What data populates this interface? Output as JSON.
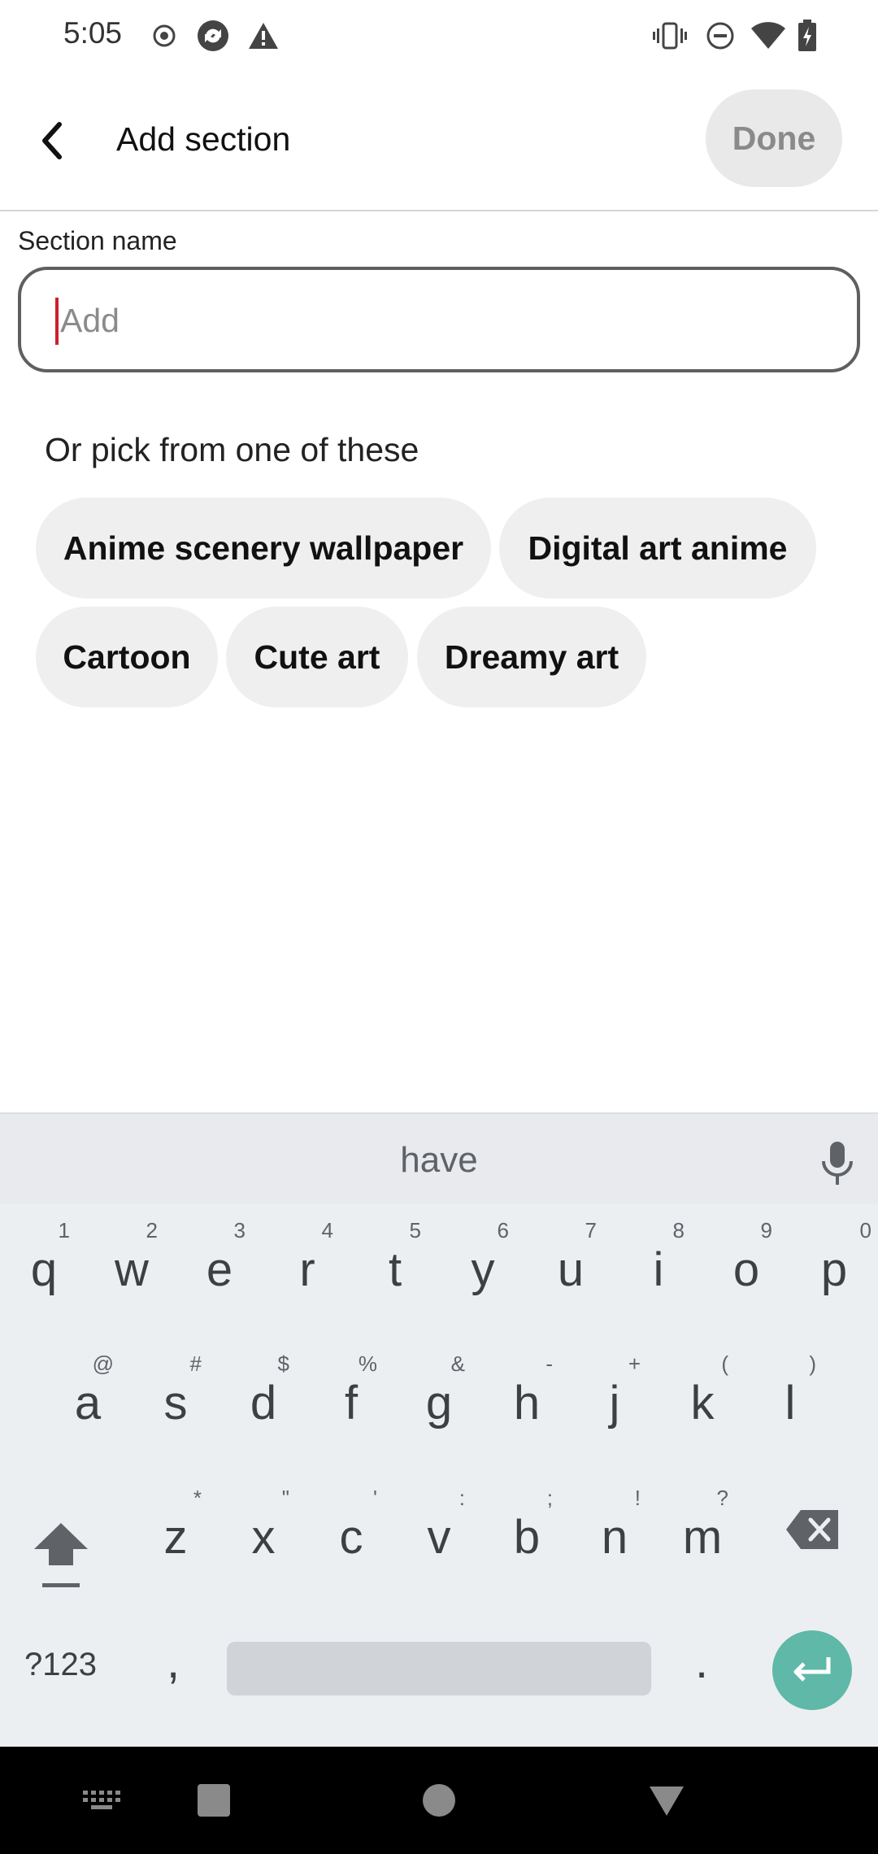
{
  "status_bar": {
    "time": "5:05",
    "left_icons": [
      "radio-icon",
      "sync-icon",
      "warning-icon"
    ],
    "right_icons": [
      "vibrate-icon",
      "do-not-disturb-icon",
      "wifi-icon",
      "battery-icon"
    ]
  },
  "header": {
    "title": "Add section",
    "done_label": "Done"
  },
  "form": {
    "label": "Section name",
    "placeholder": "Add",
    "value": ""
  },
  "suggestions": {
    "heading": "Or pick from one of these",
    "chips": [
      "Anime scenery wallpaper",
      "Digital art anime",
      "Cartoon",
      "Cute art",
      "Dreamy art"
    ]
  },
  "keyboard": {
    "suggestion": "have",
    "row1": [
      {
        "key": "q",
        "hint": "1"
      },
      {
        "key": "w",
        "hint": "2"
      },
      {
        "key": "e",
        "hint": "3"
      },
      {
        "key": "r",
        "hint": "4"
      },
      {
        "key": "t",
        "hint": "5"
      },
      {
        "key": "y",
        "hint": "6"
      },
      {
        "key": "u",
        "hint": "7"
      },
      {
        "key": "i",
        "hint": "8"
      },
      {
        "key": "o",
        "hint": "9"
      },
      {
        "key": "p",
        "hint": "0"
      }
    ],
    "row2": [
      {
        "key": "a",
        "hint": "@"
      },
      {
        "key": "s",
        "hint": "#"
      },
      {
        "key": "d",
        "hint": "$"
      },
      {
        "key": "f",
        "hint": "%"
      },
      {
        "key": "g",
        "hint": "&"
      },
      {
        "key": "h",
        "hint": "-"
      },
      {
        "key": "j",
        "hint": "+"
      },
      {
        "key": "k",
        "hint": "("
      },
      {
        "key": "l",
        "hint": ")"
      }
    ],
    "row3": [
      {
        "key": "z",
        "hint": "*"
      },
      {
        "key": "x",
        "hint": "\""
      },
      {
        "key": "c",
        "hint": "'"
      },
      {
        "key": "v",
        "hint": ":"
      },
      {
        "key": "b",
        "hint": ";"
      },
      {
        "key": "n",
        "hint": "!"
      },
      {
        "key": "m",
        "hint": "?"
      }
    ],
    "symbols_label": "?123",
    "comma": ",",
    "period": "."
  },
  "colors": {
    "cursor": "#cc1f2d",
    "enter_key": "#5fb8a8",
    "chip_bg": "#efefef",
    "keyboard_bg": "#eceff1"
  }
}
